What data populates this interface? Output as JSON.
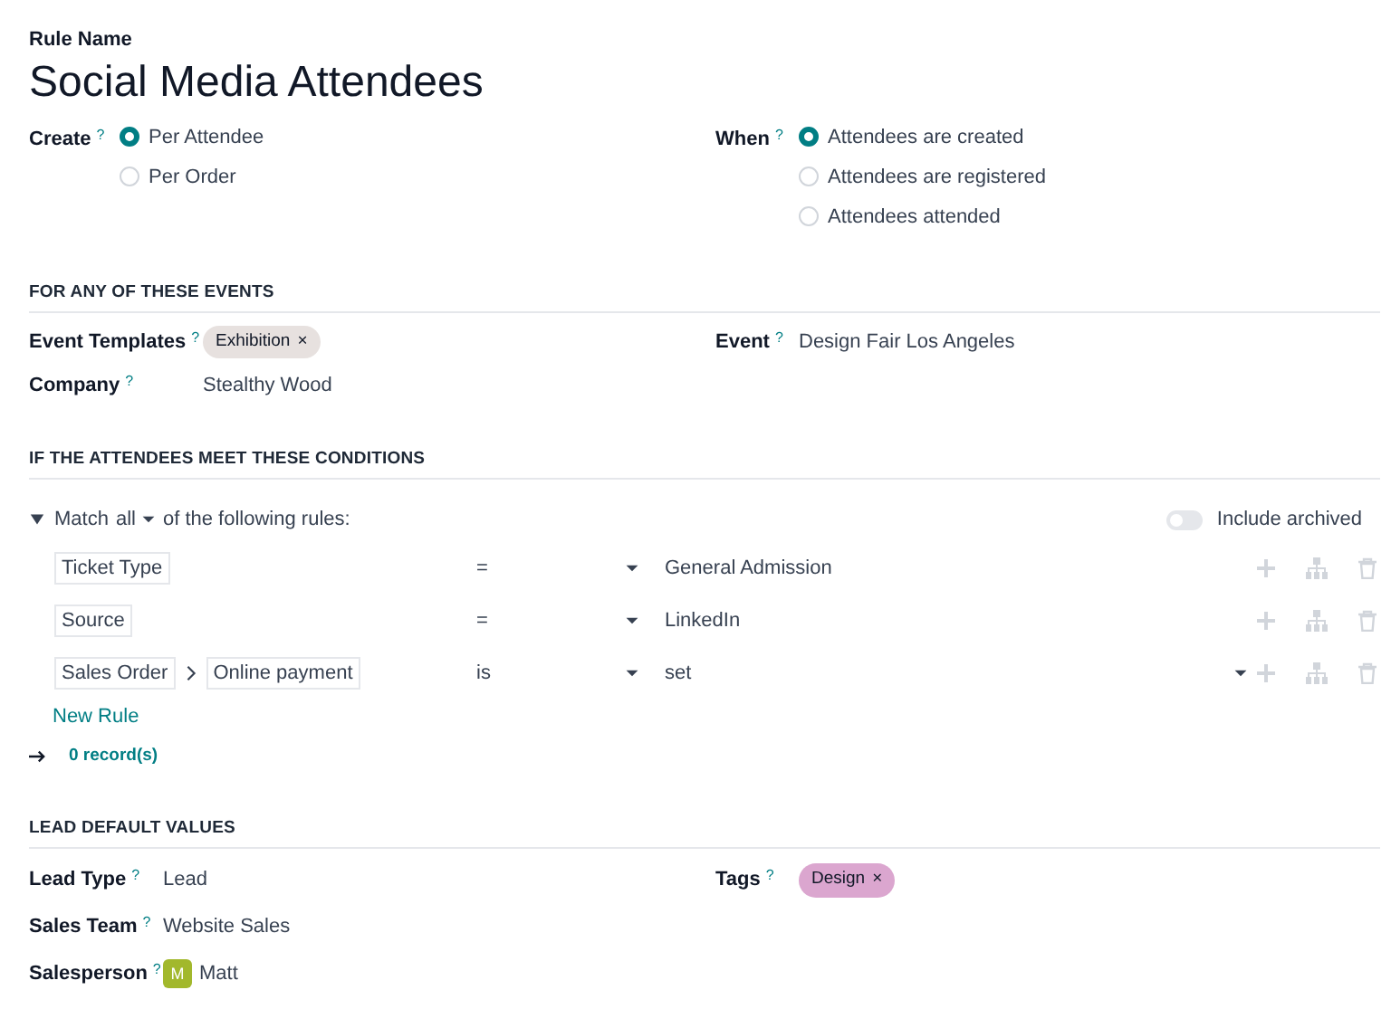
{
  "rule_name": {
    "label": "Rule Name",
    "value": "Social Media Attendees"
  },
  "create": {
    "label": "Create",
    "help": "?",
    "options": [
      {
        "label": "Per Attendee",
        "selected": true
      },
      {
        "label": "Per Order",
        "selected": false
      }
    ]
  },
  "when": {
    "label": "When",
    "help": "?",
    "options": [
      {
        "label": "Attendees are created",
        "selected": true
      },
      {
        "label": "Attendees are registered",
        "selected": false
      },
      {
        "label": "Attendees attended",
        "selected": false
      }
    ]
  },
  "events_section": {
    "title": "FOR ANY OF THESE EVENTS",
    "left": [
      {
        "label": "Event Templates",
        "help": "?",
        "kind": "tags",
        "tags": [
          {
            "label": "Exhibition",
            "remove": "×",
            "color": "#e7e1df"
          }
        ]
      },
      {
        "label": "Company",
        "help": "?",
        "kind": "text",
        "value": "Stealthy Wood"
      }
    ],
    "right": [
      {
        "label": "Event",
        "help": "?",
        "kind": "text",
        "value": "Design Fair Los Angeles"
      }
    ]
  },
  "conditions_section": {
    "title": "IF THE ATTENDEES MEET THESE CONDITIONS",
    "match": {
      "prefix": "Match",
      "mode": "all",
      "suffix": "of the following rules:",
      "expanded": true
    },
    "include_archived": {
      "label": "Include archived",
      "on": false
    },
    "rules": [
      {
        "path": [
          "Ticket Type"
        ],
        "operator": "=",
        "value": "General Admission",
        "value_dropdown": false
      },
      {
        "path": [
          "Source"
        ],
        "operator": "=",
        "value": "LinkedIn",
        "value_dropdown": false
      },
      {
        "path": [
          "Sales Order",
          "Online payment"
        ],
        "operator": "is",
        "value": "set",
        "value_dropdown": true
      }
    ],
    "new_rule": "New Rule",
    "records": "0 record(s)"
  },
  "lead_section": {
    "title": "LEAD DEFAULT VALUES",
    "left": [
      {
        "label": "Lead Type",
        "help": "?",
        "kind": "text",
        "value": "Lead"
      },
      {
        "label": "Sales Team",
        "help": "?",
        "kind": "text",
        "value": "Website Sales"
      },
      {
        "label": "Salesperson",
        "help": "?",
        "kind": "avatar",
        "initial": "M",
        "color": "#a2b82c",
        "value": "Matt"
      }
    ],
    "right": [
      {
        "label": "Tags",
        "help": "?",
        "kind": "tags",
        "tags": [
          {
            "label": "Design",
            "remove": "×",
            "color": "#dba6cf"
          }
        ]
      }
    ]
  }
}
